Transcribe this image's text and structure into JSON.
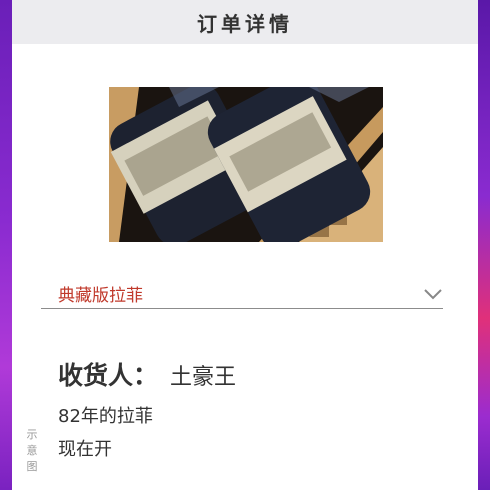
{
  "header": {
    "title": "订单详情"
  },
  "product": {
    "image_icon": "wine-bottles-in-crate-photo"
  },
  "select": {
    "value": "典藏版拉菲",
    "icon": "chevron-down-icon"
  },
  "recipient": {
    "label": "收货人：",
    "name": "土豪王"
  },
  "details": {
    "line1": "82年的拉菲",
    "line2": "现在开"
  },
  "watermark": {
    "c1": "示",
    "c2": "意",
    "c3": "图"
  },
  "colors": {
    "accent": "#c0392b",
    "header_bg": "#ececef",
    "frame": "#8a2bd0"
  }
}
